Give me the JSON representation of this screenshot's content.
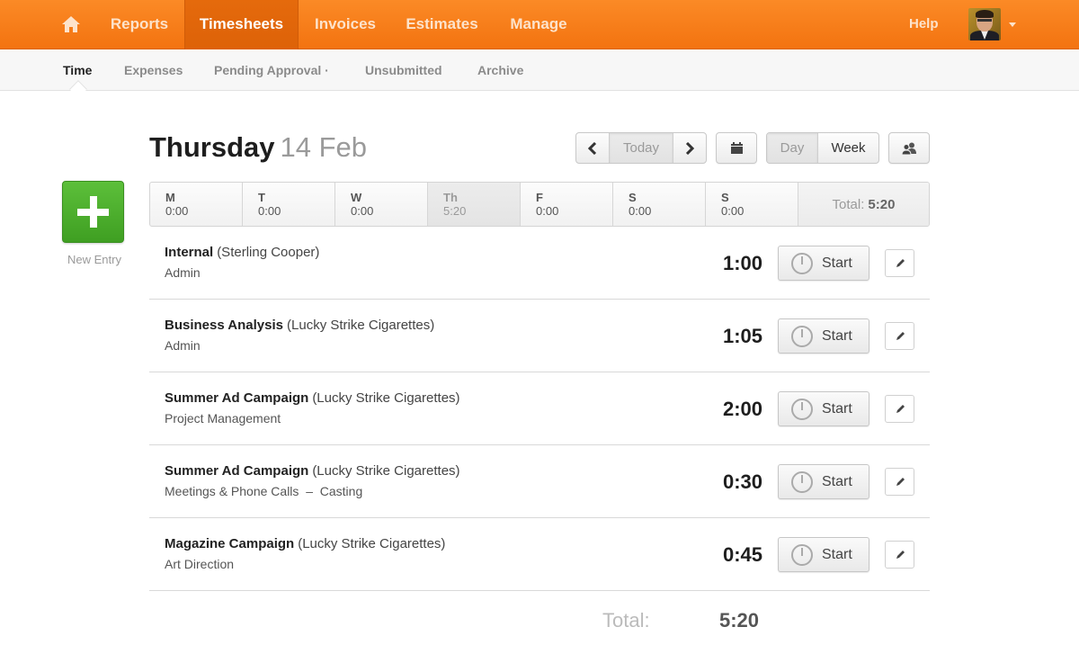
{
  "topnav": {
    "home_icon": "home-icon",
    "items": [
      {
        "label": "Reports",
        "active": false
      },
      {
        "label": "Timesheets",
        "active": true
      },
      {
        "label": "Invoices",
        "active": false
      },
      {
        "label": "Estimates",
        "active": false
      },
      {
        "label": "Manage",
        "active": false
      }
    ],
    "help_label": "Help",
    "avatar_icon": "user-avatar",
    "menu_icon": "caret-down-icon"
  },
  "subnav": {
    "items": [
      {
        "label": "Time",
        "active": true
      },
      {
        "label": "Expenses",
        "active": false
      },
      {
        "label": "Pending Approval ·",
        "active": false
      },
      {
        "label": "Unsubmitted",
        "active": false
      },
      {
        "label": "Archive",
        "active": false
      }
    ]
  },
  "header": {
    "weekday": "Thursday",
    "date": "14 Feb"
  },
  "toolbar": {
    "prev_icon": "chevron-left-icon",
    "today_label": "Today",
    "next_icon": "chevron-right-icon",
    "calendar_icon": "calendar-icon",
    "day_label": "Day",
    "week_label": "Week",
    "view_selected": "Day",
    "teammates_icon": "users-icon"
  },
  "new_entry": {
    "label": "New Entry",
    "icon": "plus-icon"
  },
  "week": {
    "days": [
      {
        "abbr": "M",
        "hours": "0:00",
        "current": false
      },
      {
        "abbr": "T",
        "hours": "0:00",
        "current": false
      },
      {
        "abbr": "W",
        "hours": "0:00",
        "current": false
      },
      {
        "abbr": "Th",
        "hours": "5:20",
        "current": true
      },
      {
        "abbr": "F",
        "hours": "0:00",
        "current": false
      },
      {
        "abbr": "S",
        "hours": "0:00",
        "current": false
      },
      {
        "abbr": "S",
        "hours": "0:00",
        "current": false
      }
    ],
    "total_label": "Total:",
    "total_value": "5:20"
  },
  "entries": [
    {
      "project": "Internal",
      "client": "(Sterling Cooper)",
      "task": "Admin",
      "hours": "1:00",
      "start_label": "Start"
    },
    {
      "project": "Business Analysis",
      "client": "(Lucky Strike Cigarettes)",
      "task": "Admin",
      "hours": "1:05",
      "start_label": "Start"
    },
    {
      "project": "Summer Ad Campaign",
      "client": "(Lucky Strike Cigarettes)",
      "task": "Project Management",
      "hours": "2:00",
      "start_label": "Start"
    },
    {
      "project": "Summer Ad Campaign",
      "client": "(Lucky Strike Cigarettes)",
      "task": "Meetings & Phone Calls  –  Casting",
      "hours": "0:30",
      "start_label": "Start"
    },
    {
      "project": "Magazine Campaign",
      "client": "(Lucky Strike Cigarettes)",
      "task": "Art Direction",
      "hours": "0:45",
      "start_label": "Start"
    }
  ],
  "footer": {
    "total_label": "Total:",
    "total_value": "5:20"
  },
  "colors": {
    "brand_orange": "#f37310",
    "new_entry_green": "#4caf2e"
  }
}
